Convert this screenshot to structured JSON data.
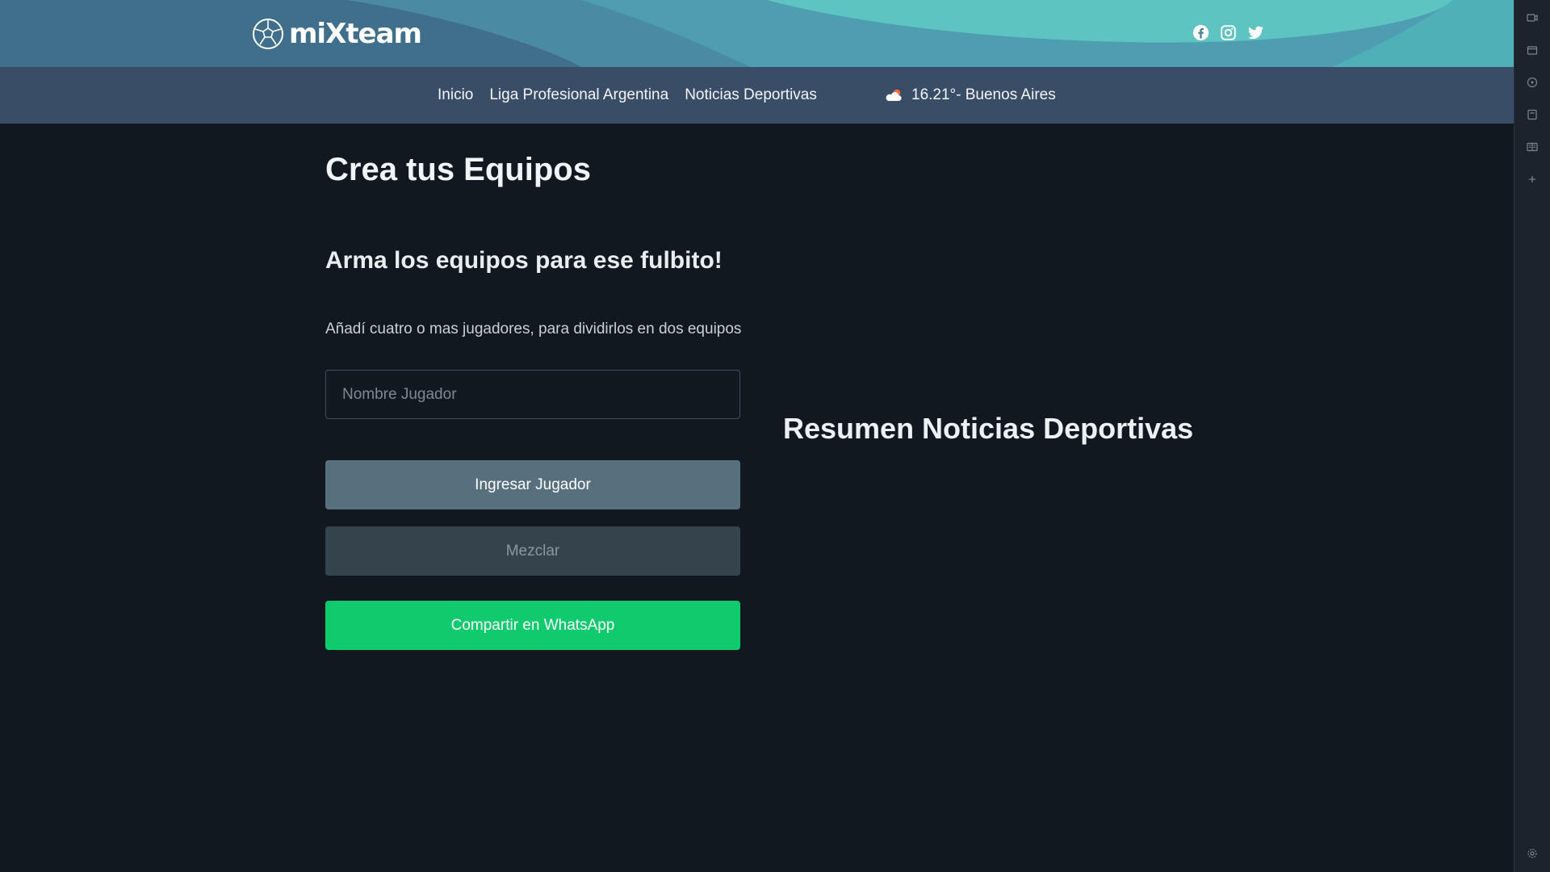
{
  "header": {
    "brand": "miXteam",
    "logo_icon": "soccer-ball-icon",
    "social_icons": [
      "facebook-icon",
      "instagram-icon",
      "twitter-icon"
    ],
    "colors": {
      "hero_dark": "#3f6f8a",
      "hero_light": "#5ec4c2"
    }
  },
  "nav": {
    "items": [
      {
        "label": "Inicio"
      },
      {
        "label": "Liga Profesional Argentina"
      },
      {
        "label": "Noticias Deportivas"
      }
    ],
    "weather": {
      "icon": "cloudy-sun-icon",
      "text": "16.21°- Buenos Aires"
    },
    "background": "#3a4d66"
  },
  "main": {
    "title": "Crea tus Equipos",
    "subtitle": "Arma los equipos para ese fulbito!",
    "instructions": "Añadí cuatro o mas jugadores, para dividirlos en dos equipos",
    "player_input": {
      "placeholder": "Nombre Jugador",
      "value": ""
    },
    "buttons": {
      "add": "Ingresar Jugador",
      "mix": "Mezclar",
      "whatsapp": "Compartir en WhatsApp"
    },
    "colors": {
      "add": "#58707d",
      "mix": "#35444c",
      "whatsapp": "#0fcb6e"
    }
  },
  "news": {
    "title": "Resumen Noticias Deportivas"
  },
  "browser_sidebar": {
    "icons": [
      "video-icon",
      "wallet-icon",
      "chat-icon",
      "save-icon",
      "reader-icon",
      "plus-icon",
      "settings-icon"
    ]
  }
}
